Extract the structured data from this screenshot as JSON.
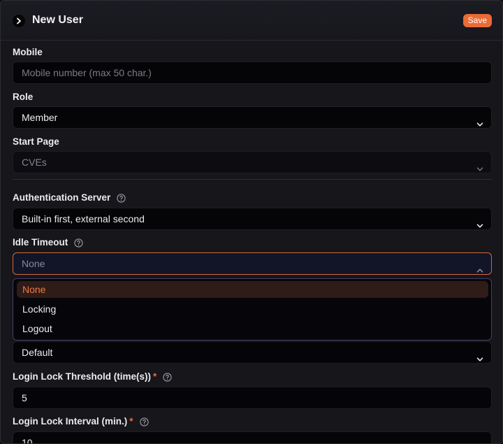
{
  "header": {
    "title": "New User",
    "save_label": "Save"
  },
  "fields": {
    "mobile": {
      "label": "Mobile",
      "placeholder": "Mobile number (max 50 char.)"
    },
    "role": {
      "label": "Role",
      "value": "Member"
    },
    "start_page": {
      "label": "Start Page",
      "value": "CVEs"
    },
    "auth_server": {
      "label": "Authentication Server",
      "value": "Built-in first, external second"
    },
    "idle_timeout": {
      "label": "Idle Timeout",
      "value": "None",
      "options": [
        "None",
        "Locking",
        "Logout"
      ],
      "selected_index": 0
    },
    "hidden_select": {
      "value": "Default"
    },
    "login_lock_threshold": {
      "label": "Login Lock Threshold (time(s))",
      "required_mark": "*",
      "value": "5"
    },
    "login_lock_interval": {
      "label": "Login Lock Interval (min.)",
      "required_mark": "*",
      "value": "10"
    }
  },
  "colors": {
    "accent": "#ec6a35",
    "field_bg": "#050508",
    "panel_bg": "#16161b"
  }
}
